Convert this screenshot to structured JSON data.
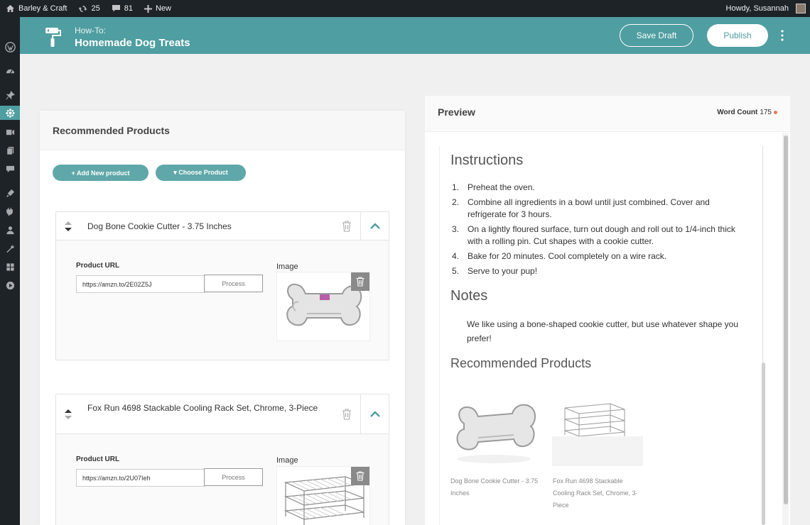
{
  "adminbar": {
    "site_name": "Barley & Craft",
    "updates_count": "25",
    "comments_count": "81",
    "new_label": "New",
    "howdy": "Howdy, Susannah"
  },
  "header": {
    "kicker": "How-To:",
    "title": "Homemade Dog Treats",
    "save_draft": "Save Draft",
    "publish": "Publish"
  },
  "left_panel": {
    "title": "Recommended Products",
    "add_new": "+ Add New product",
    "choose": "▾ Choose Product",
    "products": [
      {
        "title": "Dog Bone Cookie Cutter - 3.75 Inches",
        "url_label": "Product URL",
        "url": "https://amzn.to/2E02Z5J",
        "process": "Process",
        "image_label": "Image"
      },
      {
        "title": "Fox Run 4698 Stackable Cooling Rack Set, Chrome, 3-Piece",
        "url_label": "Product URL",
        "url": "https://amzn.to/2U07Ieh",
        "process": "Process",
        "image_label": "Image"
      }
    ]
  },
  "preview": {
    "title": "Preview",
    "word_count_label": "Word Count",
    "word_count": "175",
    "instructions_heading": "Instructions",
    "steps": [
      "Preheat the oven.",
      "Combine all ingredients in a bowl until just combined. Cover and refrigerate for 3 hours.",
      "On a lightly floured surface, turn out dough and roll out to 1/4-inch thick with a rolling pin. Cut shapes with a cookie cutter.",
      "Bake for 20 minutes. Cool completely on a wire rack.",
      "Serve to your pup!"
    ],
    "step_numbers": [
      "1.",
      "2.",
      "3.",
      "4.",
      "5."
    ],
    "notes_heading": "Notes",
    "notes": "We like using a bone-shaped cookie cutter, but use whatever shape you prefer!",
    "rec_heading": "Recommended Products",
    "rec_items": [
      {
        "caption": "Dog Bone Cookie Cutter - 3.75 Inches"
      },
      {
        "caption": "Fox Run 4698 Stackable Cooling Rack Set, Chrome, 3-Piece"
      }
    ]
  },
  "colors": {
    "accent": "#4f9ea1",
    "admin_dark": "#1d2327",
    "word_count_dot": "#e9765b"
  },
  "icons": {
    "adminbar": [
      "home-icon",
      "updates-icon",
      "comments-icon",
      "plus-icon"
    ],
    "menu": [
      "wordpress-logo-icon",
      "dashboard-icon",
      "pin-icon",
      "gear-flower-icon",
      "media-icon",
      "pages-icon",
      "comments-icon",
      "appearance-icon",
      "plugins-icon",
      "users-icon",
      "tools-icon",
      "settings-icon",
      "play-icon"
    ]
  }
}
